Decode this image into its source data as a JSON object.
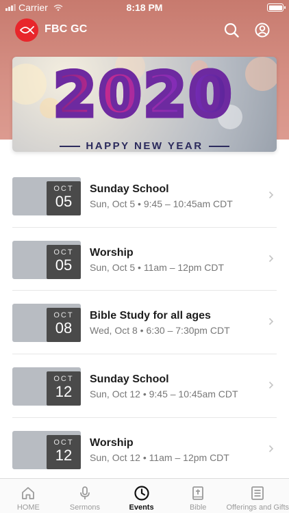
{
  "status_bar": {
    "carrier": "Carrier",
    "time": "8:18 PM"
  },
  "app": {
    "title": "FBC GC"
  },
  "banner": {
    "year": "2020",
    "subtitle": "HAPPY NEW YEAR"
  },
  "events": [
    {
      "month": "OCT",
      "day": "05",
      "title": "Sunday School",
      "subtitle": "Sun, Oct 5 • 9:45 – 10:45am CDT"
    },
    {
      "month": "OCT",
      "day": "05",
      "title": "Worship",
      "subtitle": "Sun, Oct 5 • 11am – 12pm CDT"
    },
    {
      "month": "OCT",
      "day": "08",
      "title": "Bible Study for all ages",
      "subtitle": "Wed, Oct 8 • 6:30 – 7:30pm CDT"
    },
    {
      "month": "OCT",
      "day": "12",
      "title": "Sunday School",
      "subtitle": "Sun, Oct 12 • 9:45 – 10:45am CDT"
    },
    {
      "month": "OCT",
      "day": "12",
      "title": "Worship",
      "subtitle": "Sun, Oct 12 • 11am – 12pm CDT"
    }
  ],
  "tabs": [
    {
      "label": "HOME",
      "icon": "home-icon"
    },
    {
      "label": "Sermons",
      "icon": "microphone-icon"
    },
    {
      "label": "Events",
      "icon": "clock-icon",
      "active": true
    },
    {
      "label": "Bible",
      "icon": "bible-icon"
    },
    {
      "label": "Offerings and Gifts",
      "icon": "offering-icon"
    }
  ],
  "colors": {
    "header": "#c77a6e",
    "logo": "#e8262b",
    "date_box": "#4a4a4a"
  }
}
